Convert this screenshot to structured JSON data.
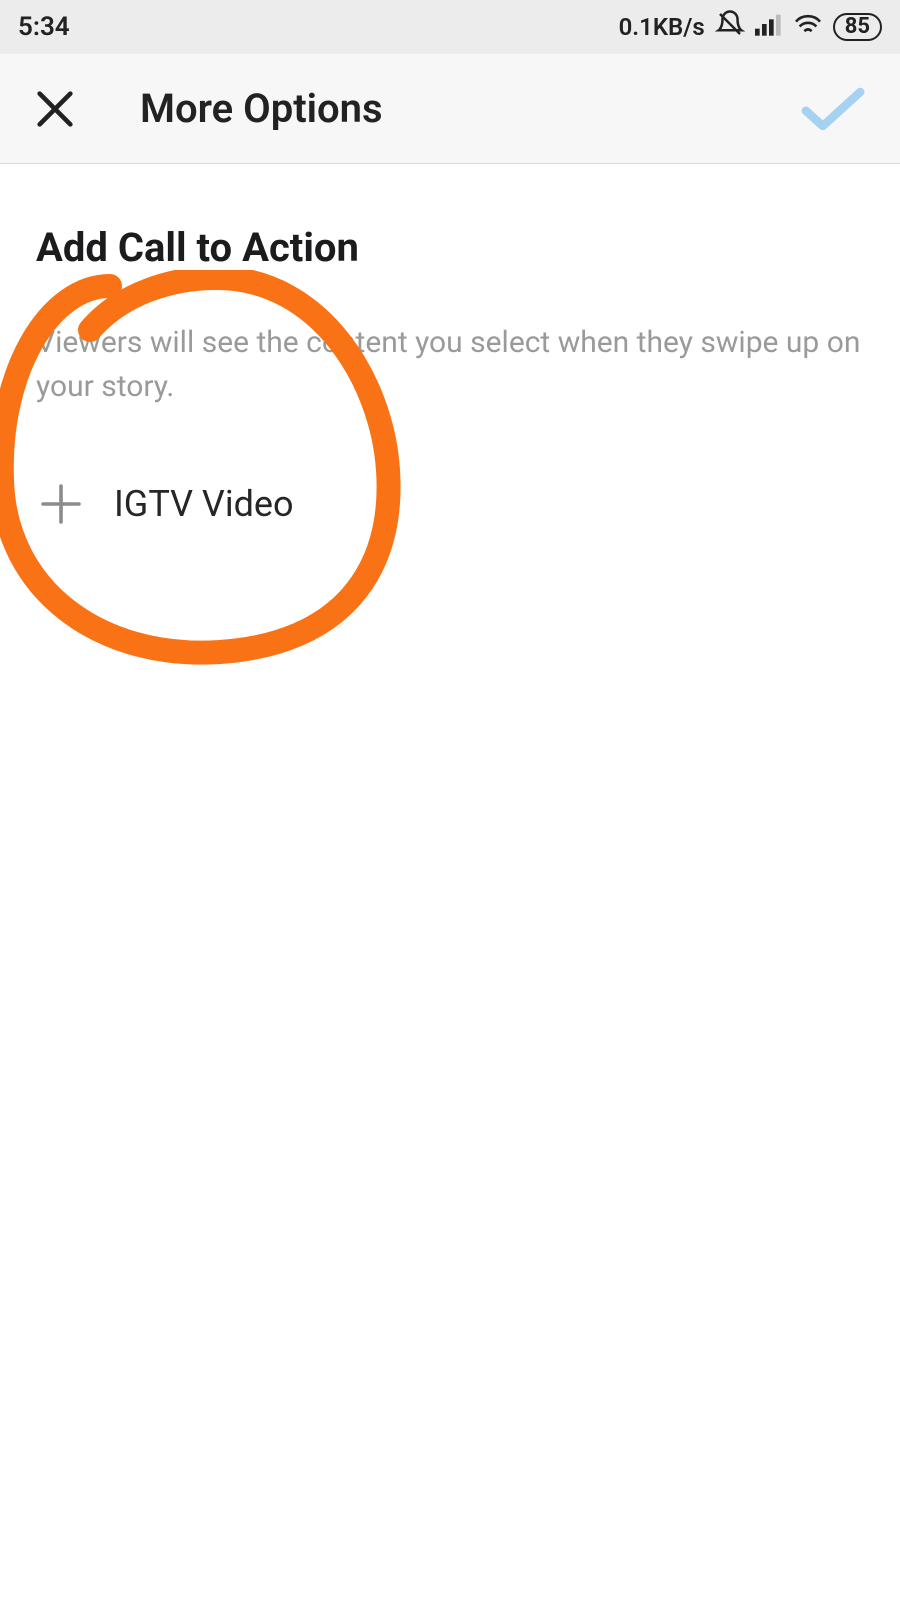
{
  "status_bar": {
    "time": "5:34",
    "data_rate": "0.1KB/s",
    "battery": "85"
  },
  "header": {
    "title": "More Options"
  },
  "content": {
    "section_title": "Add Call to Action",
    "description": "Viewers will see the content you select when they swipe up on your story.",
    "option_label": "IGTV Video"
  },
  "annotation": {
    "color": "#f97316"
  }
}
